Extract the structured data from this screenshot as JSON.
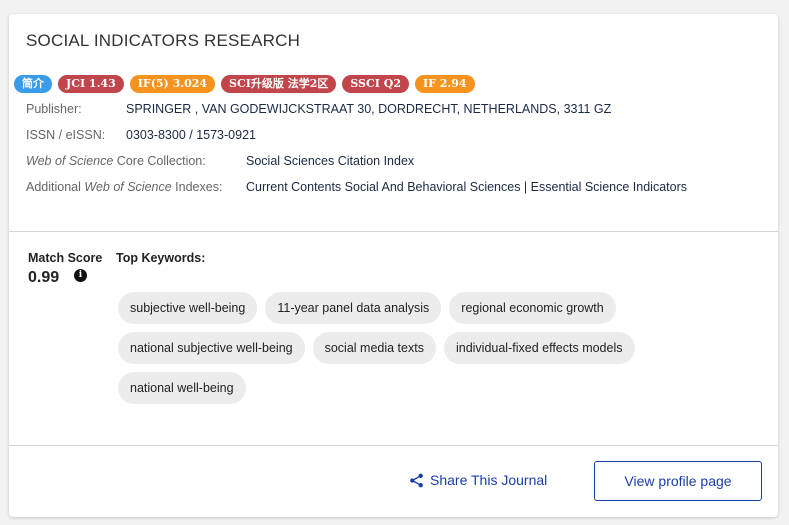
{
  "journal": {
    "title": "SOCIAL INDICATORS RESEARCH"
  },
  "badges": [
    {
      "label": "简介",
      "color": "#3a9bea"
    },
    {
      "label": "JCI 1.43",
      "color": "#c0464b"
    },
    {
      "label": "IF(5) 3.024",
      "color": "#f6931e"
    },
    {
      "label": "SCI升级版 法学2区",
      "color": "#c0464b"
    },
    {
      "label": "SSCI Q2",
      "color": "#c0464b"
    },
    {
      "label": "IF 2.94",
      "color": "#f6931e"
    }
  ],
  "info": {
    "publisher_label": "Publisher:",
    "publisher_value": "SPRINGER , VAN GODEWIJCKSTRAAT 30, DORDRECHT, NETHERLANDS, 3311 GZ",
    "issn_label": "ISSN / eISSN:",
    "issn_value": "0303-8300 / 1573-0921",
    "wos_label_italic": "Web of Science",
    "wos_label_rest": " Core Collection:",
    "wos_value": "Social Sciences Citation Index",
    "additional_label_pre": "Additional ",
    "additional_label_italic": "Web of Science",
    "additional_label_post": " Indexes:",
    "additional_value": "Current Contents Social And Behavioral Sciences | Essential Science Indicators"
  },
  "match": {
    "label": "Match Score",
    "value": "0.99",
    "info_icon": "info-icon"
  },
  "keywords": {
    "label": "Top Keywords:",
    "rows": [
      [
        "subjective well-being",
        "11-year panel data analysis",
        "regional economic growth"
      ],
      [
        "national subjective well-being",
        "social media texts",
        "individual-fixed effects models"
      ],
      [
        "national well-being"
      ]
    ]
  },
  "actions": {
    "share_label": "Share This Journal",
    "share_icon": "share-icon",
    "view_label": "View profile page",
    "accent_color": "#1a3ea8"
  }
}
